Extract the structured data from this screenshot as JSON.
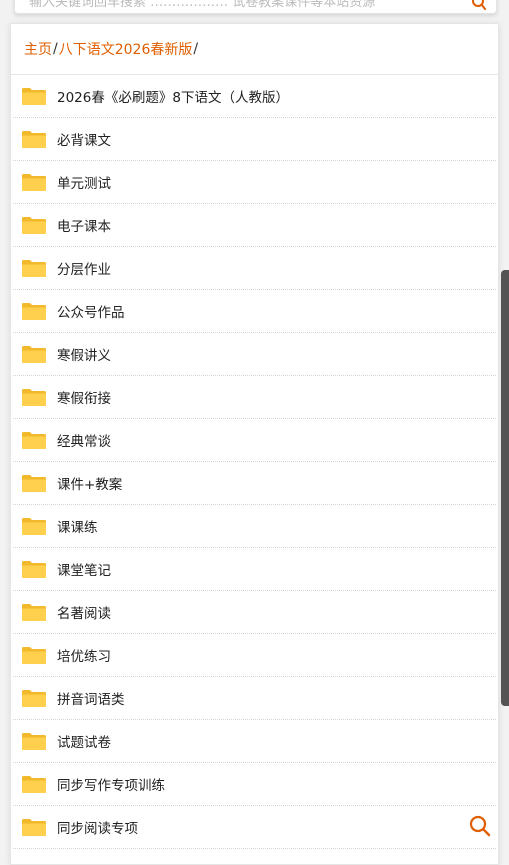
{
  "search": {
    "placeholder_partial": "输入关键词回车搜索 ……………… 试卷教案课件等本站资源",
    "icon": "search-icon"
  },
  "breadcrumb": {
    "home": "主页",
    "separator": "/",
    "current": "八下语文2026春新版",
    "trailing_separator": "/"
  },
  "folders": [
    {
      "label": "2026春《必刷题》8下语文（人教版）"
    },
    {
      "label": "必背课文"
    },
    {
      "label": "单元测试"
    },
    {
      "label": "电子课本"
    },
    {
      "label": "分层作业"
    },
    {
      "label": "公众号作品"
    },
    {
      "label": "寒假讲义"
    },
    {
      "label": "寒假衔接"
    },
    {
      "label": "经典常谈"
    },
    {
      "label": "课件+教案"
    },
    {
      "label": "课课练"
    },
    {
      "label": "课堂笔记"
    },
    {
      "label": "名著阅读"
    },
    {
      "label": "培优练习"
    },
    {
      "label": "拼音词语类"
    },
    {
      "label": "试题试卷"
    },
    {
      "label": "同步写作专项训练"
    },
    {
      "label": "同步阅读专项"
    }
  ],
  "colors": {
    "accent": "#e05d00",
    "folder_body": "#ffd04d",
    "folder_back": "#f2b92c",
    "scrollbar": "#545454"
  }
}
